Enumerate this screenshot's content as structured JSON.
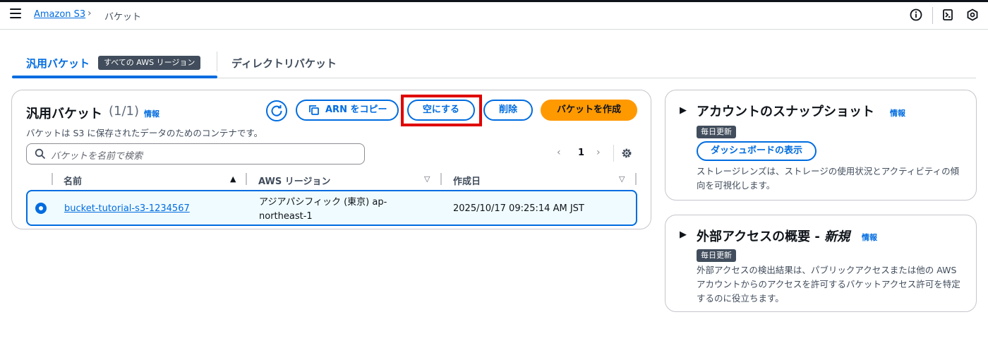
{
  "breadcrumb": {
    "root": "Amazon S3",
    "current": "バケット"
  },
  "topbar": {
    "icons": [
      "info-icon",
      "cloudshell-icon",
      "notifications-icon"
    ]
  },
  "tabs": [
    {
      "label": "汎用バケット",
      "badge": "すべての AWS リージョン",
      "active": true
    },
    {
      "label": "ディレクトリバケット",
      "active": false
    }
  ],
  "panel": {
    "title": "汎用バケット",
    "count": "(1/1)",
    "info": "情報",
    "description": "バケットは S3 に保存されたデータのためのコンテナです。",
    "buttons": {
      "copy_arn": "ARN をコピー",
      "empty": "空にする",
      "delete": "削除",
      "create": "バケットを作成"
    },
    "search_placeholder": "バケットを名前で検索",
    "page": "1",
    "columns": [
      "名前",
      "AWS リージョン",
      "作成日"
    ],
    "rows": [
      {
        "name": "bucket-tutorial-s3-1234567",
        "region": "アジアパシフィック (東京) ap-northeast-1",
        "created": "2025/10/17 09:25:14 AM JST",
        "selected": true
      }
    ]
  },
  "cards": [
    {
      "title": "アカウントのスナップショット",
      "info": "情報",
      "badge": "毎日更新",
      "button": "ダッシュボードの表示",
      "text": "ストレージレンズは、ストレージの使用状況とアクティビティの傾向を可視化します。"
    },
    {
      "title": "外部アクセスの概要 - ",
      "title_em": "新規",
      "info": "情報",
      "badge": "毎日更新",
      "text": "外部アクセスの検出結果は、パブリックアクセスまたは他の AWS アカウントからのアクセスを許可するバケットアクセス許可を特定するのに役立ちます。"
    }
  ],
  "colors": {
    "accent": "#006ce0",
    "primary_button": "#ff9900",
    "highlight": "#e00000"
  }
}
